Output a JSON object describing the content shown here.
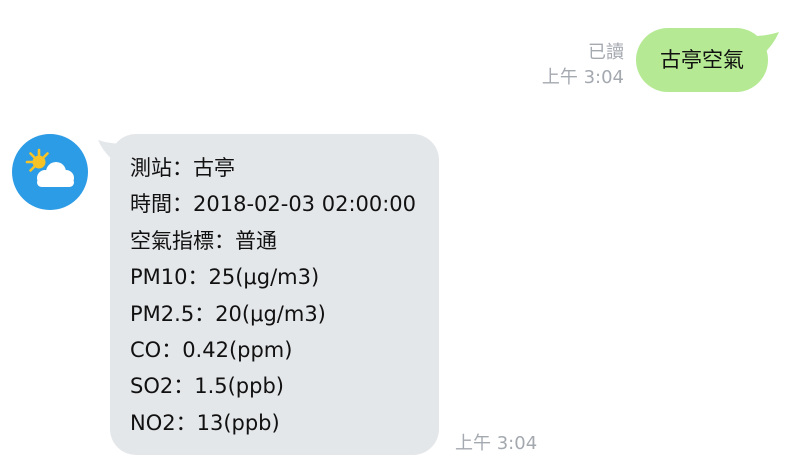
{
  "outgoing": {
    "text": "古亭空氣",
    "read_status": "已讀",
    "time": "上午 3:04",
    "bubble_color": "#b5e993"
  },
  "incoming": {
    "avatar_icon": "partly-cloudy-weather-icon",
    "avatar_color": "#2d9ce6",
    "bubble_color": "#e4e7ea",
    "lines": [
      "測站：古亭",
      "時間：2018-02-03 02:00:00",
      "空氣指標：普通",
      "PM10：25(μg/m3)",
      "PM2.5：20(μg/m3)",
      "CO：0.42(ppm)",
      "SO2：1.5(ppb)",
      "NO2：13(ppb)"
    ],
    "time": "上午 3:04"
  }
}
